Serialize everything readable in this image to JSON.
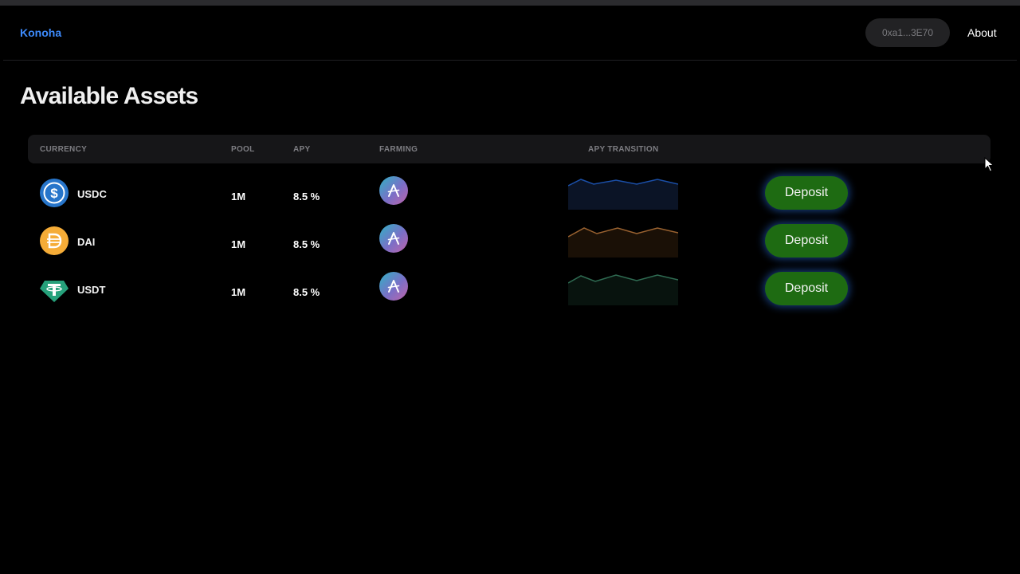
{
  "navbar": {
    "brand": "Konoha",
    "wallet": "0xa1...3E70",
    "about": "About"
  },
  "page": {
    "title": "Available Assets"
  },
  "table": {
    "columns": [
      "CURRENCY",
      "POOL",
      "APY",
      "FARMING",
      "APY TRANSITION"
    ],
    "rows": [
      {
        "currency": "USDC",
        "icon": "usdc-icon",
        "pool": "1M",
        "apy": "8.5 %",
        "farming_icon": "aave-icon",
        "trend_color": "#1b4fa8",
        "action": "Deposit"
      },
      {
        "currency": "DAI",
        "icon": "dai-icon",
        "pool": "1M",
        "apy": "8.5 %",
        "farming_icon": "aave-icon",
        "trend_color": "#9a6230",
        "action": "Deposit"
      },
      {
        "currency": "USDT",
        "icon": "usdt-icon",
        "pool": "1M",
        "apy": "8.5 %",
        "farming_icon": "aave-icon",
        "trend_color": "#2f6b52",
        "action": "Deposit"
      }
    ]
  },
  "colors": {
    "brand": "#3d8bfd",
    "deposit_bg": "#1e6b12",
    "deposit_glow": "#286edc",
    "usdc": "#2775ca",
    "dai": "#f5ac37",
    "usdt": "#26a17b"
  }
}
